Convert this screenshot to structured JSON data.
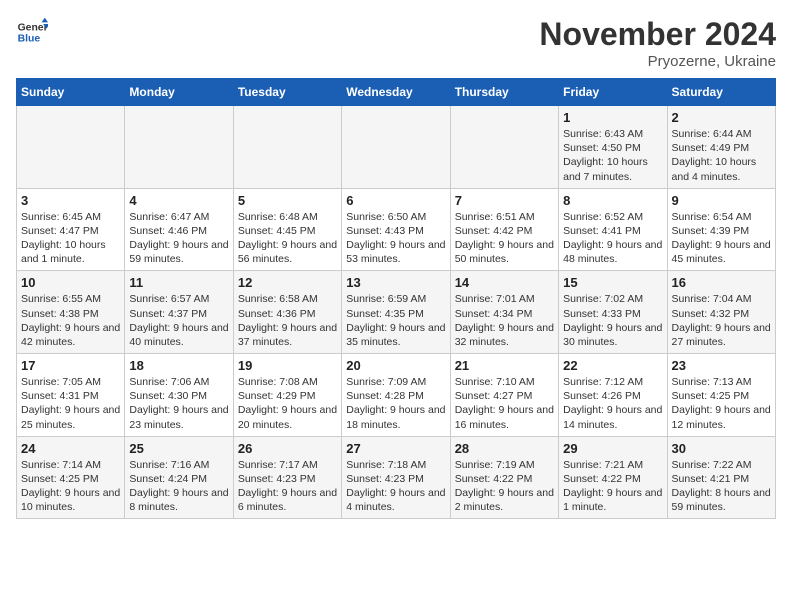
{
  "header": {
    "logo_line1": "General",
    "logo_line2": "Blue",
    "month_year": "November 2024",
    "location": "Pryozerne, Ukraine"
  },
  "weekdays": [
    "Sunday",
    "Monday",
    "Tuesday",
    "Wednesday",
    "Thursday",
    "Friday",
    "Saturday"
  ],
  "weeks": [
    [
      {
        "day": "",
        "info": ""
      },
      {
        "day": "",
        "info": ""
      },
      {
        "day": "",
        "info": ""
      },
      {
        "day": "",
        "info": ""
      },
      {
        "day": "",
        "info": ""
      },
      {
        "day": "1",
        "info": "Sunrise: 6:43 AM\nSunset: 4:50 PM\nDaylight: 10 hours and 7 minutes."
      },
      {
        "day": "2",
        "info": "Sunrise: 6:44 AM\nSunset: 4:49 PM\nDaylight: 10 hours and 4 minutes."
      }
    ],
    [
      {
        "day": "3",
        "info": "Sunrise: 6:45 AM\nSunset: 4:47 PM\nDaylight: 10 hours and 1 minute."
      },
      {
        "day": "4",
        "info": "Sunrise: 6:47 AM\nSunset: 4:46 PM\nDaylight: 9 hours and 59 minutes."
      },
      {
        "day": "5",
        "info": "Sunrise: 6:48 AM\nSunset: 4:45 PM\nDaylight: 9 hours and 56 minutes."
      },
      {
        "day": "6",
        "info": "Sunrise: 6:50 AM\nSunset: 4:43 PM\nDaylight: 9 hours and 53 minutes."
      },
      {
        "day": "7",
        "info": "Sunrise: 6:51 AM\nSunset: 4:42 PM\nDaylight: 9 hours and 50 minutes."
      },
      {
        "day": "8",
        "info": "Sunrise: 6:52 AM\nSunset: 4:41 PM\nDaylight: 9 hours and 48 minutes."
      },
      {
        "day": "9",
        "info": "Sunrise: 6:54 AM\nSunset: 4:39 PM\nDaylight: 9 hours and 45 minutes."
      }
    ],
    [
      {
        "day": "10",
        "info": "Sunrise: 6:55 AM\nSunset: 4:38 PM\nDaylight: 9 hours and 42 minutes."
      },
      {
        "day": "11",
        "info": "Sunrise: 6:57 AM\nSunset: 4:37 PM\nDaylight: 9 hours and 40 minutes."
      },
      {
        "day": "12",
        "info": "Sunrise: 6:58 AM\nSunset: 4:36 PM\nDaylight: 9 hours and 37 minutes."
      },
      {
        "day": "13",
        "info": "Sunrise: 6:59 AM\nSunset: 4:35 PM\nDaylight: 9 hours and 35 minutes."
      },
      {
        "day": "14",
        "info": "Sunrise: 7:01 AM\nSunset: 4:34 PM\nDaylight: 9 hours and 32 minutes."
      },
      {
        "day": "15",
        "info": "Sunrise: 7:02 AM\nSunset: 4:33 PM\nDaylight: 9 hours and 30 minutes."
      },
      {
        "day": "16",
        "info": "Sunrise: 7:04 AM\nSunset: 4:32 PM\nDaylight: 9 hours and 27 minutes."
      }
    ],
    [
      {
        "day": "17",
        "info": "Sunrise: 7:05 AM\nSunset: 4:31 PM\nDaylight: 9 hours and 25 minutes."
      },
      {
        "day": "18",
        "info": "Sunrise: 7:06 AM\nSunset: 4:30 PM\nDaylight: 9 hours and 23 minutes."
      },
      {
        "day": "19",
        "info": "Sunrise: 7:08 AM\nSunset: 4:29 PM\nDaylight: 9 hours and 20 minutes."
      },
      {
        "day": "20",
        "info": "Sunrise: 7:09 AM\nSunset: 4:28 PM\nDaylight: 9 hours and 18 minutes."
      },
      {
        "day": "21",
        "info": "Sunrise: 7:10 AM\nSunset: 4:27 PM\nDaylight: 9 hours and 16 minutes."
      },
      {
        "day": "22",
        "info": "Sunrise: 7:12 AM\nSunset: 4:26 PM\nDaylight: 9 hours and 14 minutes."
      },
      {
        "day": "23",
        "info": "Sunrise: 7:13 AM\nSunset: 4:25 PM\nDaylight: 9 hours and 12 minutes."
      }
    ],
    [
      {
        "day": "24",
        "info": "Sunrise: 7:14 AM\nSunset: 4:25 PM\nDaylight: 9 hours and 10 minutes."
      },
      {
        "day": "25",
        "info": "Sunrise: 7:16 AM\nSunset: 4:24 PM\nDaylight: 9 hours and 8 minutes."
      },
      {
        "day": "26",
        "info": "Sunrise: 7:17 AM\nSunset: 4:23 PM\nDaylight: 9 hours and 6 minutes."
      },
      {
        "day": "27",
        "info": "Sunrise: 7:18 AM\nSunset: 4:23 PM\nDaylight: 9 hours and 4 minutes."
      },
      {
        "day": "28",
        "info": "Sunrise: 7:19 AM\nSunset: 4:22 PM\nDaylight: 9 hours and 2 minutes."
      },
      {
        "day": "29",
        "info": "Sunrise: 7:21 AM\nSunset: 4:22 PM\nDaylight: 9 hours and 1 minute."
      },
      {
        "day": "30",
        "info": "Sunrise: 7:22 AM\nSunset: 4:21 PM\nDaylight: 8 hours and 59 minutes."
      }
    ]
  ]
}
